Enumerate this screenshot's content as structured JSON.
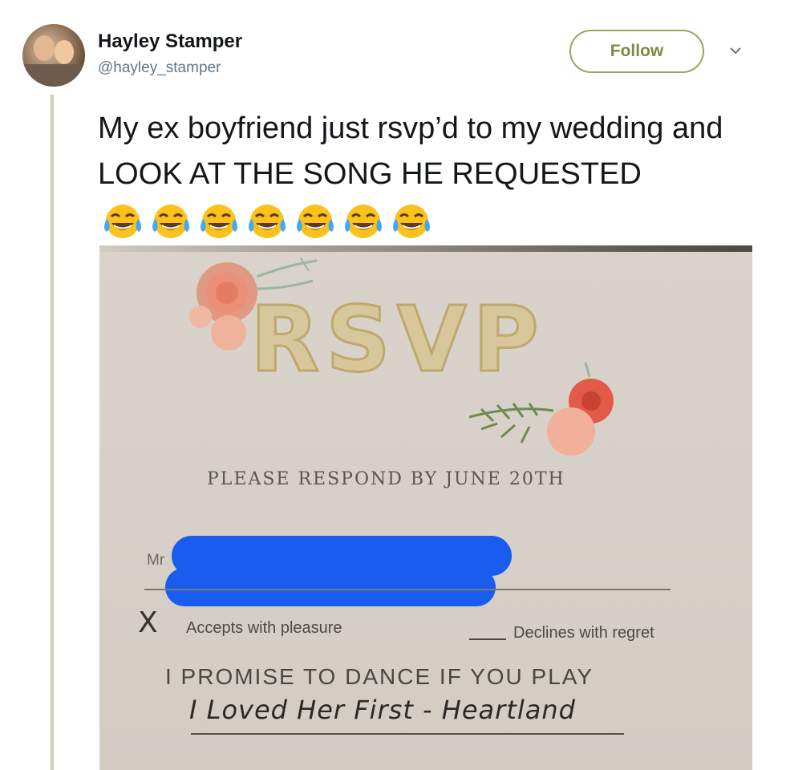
{
  "tweet": {
    "display_name": "Hayley Stamper",
    "handle": "@hayley_stamper",
    "follow_label": "Follow",
    "text": "My ex boyfriend just rsvp’d to my wedding and LOOK AT THE SONG HE REQUESTED",
    "emojis": [
      "face-with-tears-of-joy",
      "face-with-tears-of-joy",
      "face-with-tears-of-joy",
      "face-with-tears-of-joy",
      "face-with-tears-of-joy",
      "face-with-tears-of-joy",
      "face-with-tears-of-joy"
    ]
  },
  "photo": {
    "rsvp_title": "RSVP",
    "respond_by": "PLEASE RESPOND BY JUNE 20TH",
    "name_prefix": "Mr",
    "x_mark": "X",
    "accepts": "Accepts with pleasure",
    "declines": "Declines with regret",
    "promise": "I PROMISE TO DANCE IF YOU PLAY",
    "song": "I Loved Her First - Heartland"
  },
  "colors": {
    "follow_border": "#9aa55e",
    "thread_line": "#c8d2b8",
    "redaction": "#1a5cf0",
    "rsvp_gold": "#d7c79a"
  }
}
